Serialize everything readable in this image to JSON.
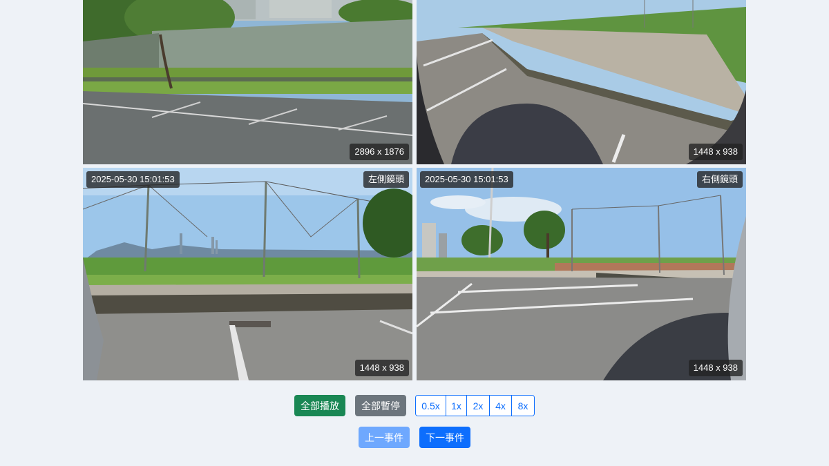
{
  "cameras": {
    "front": {
      "resolution": "2896 x 1876"
    },
    "back": {
      "resolution": "1448 x 938"
    },
    "left": {
      "timestamp": "2025-05-30 15:01:53",
      "label": "左側鏡頭",
      "resolution": "1448 x 938"
    },
    "right": {
      "timestamp": "2025-05-30 15:01:53",
      "label": "右側鏡頭",
      "resolution": "1448 x 938"
    }
  },
  "controls": {
    "play_all": "全部播放",
    "pause_all": "全部暫停",
    "speeds": [
      "0.5x",
      "1x",
      "2x",
      "4x",
      "8x"
    ]
  },
  "navigation": {
    "prev_event": "上一事件",
    "next_event": "下一事件"
  },
  "colors": {
    "play": "#198754",
    "pause": "#6c757d",
    "speed_outline": "#0d6efd",
    "prev_disabled": "#6ea8fe",
    "next": "#0d6efd",
    "page_bg": "#eef2f7"
  }
}
